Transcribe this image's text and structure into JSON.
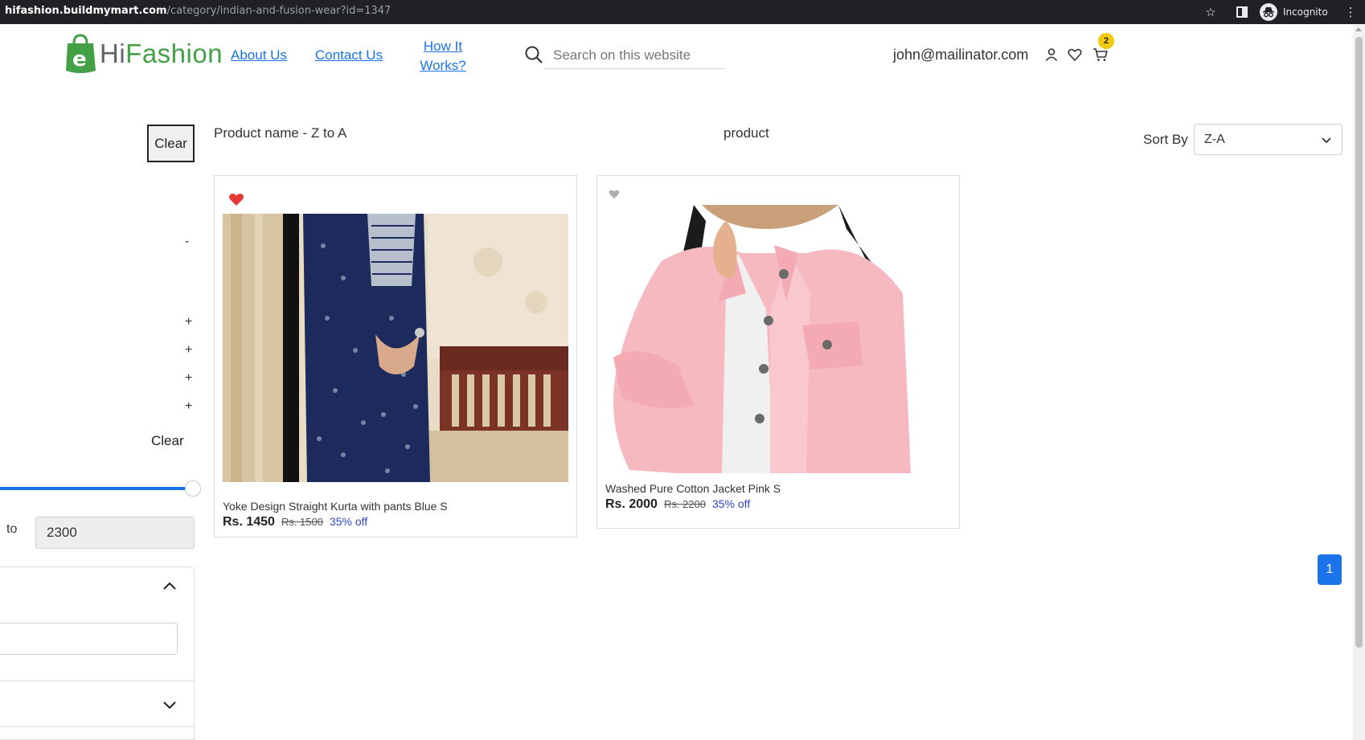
{
  "browser": {
    "url_host": "hifashion.buildmymart.com",
    "url_path": "/category/indian-and-fusion-wear?id=1347",
    "profile_label": "Incognito"
  },
  "header": {
    "logo_hi": "Hi",
    "logo_fashion": "Fashion",
    "nav": {
      "about": "About Us",
      "contact": "Contact Us",
      "how_line1": "How It",
      "how_line2": "Works?"
    },
    "search_placeholder": "Search on this website",
    "user_email": "john@mailinator.com",
    "cart_count": "2"
  },
  "filters": {
    "clear_top": "Clear",
    "toggles": [
      "-",
      "+",
      "+",
      "+",
      "+"
    ],
    "clear_price": "Clear",
    "to_label": "to",
    "price_max": "2300",
    "slider_fraction": 1.0
  },
  "listing": {
    "sort_description": "Product name - Z to A",
    "category_label": "product",
    "sort_by_label": "Sort By",
    "sort_value": "Z-A",
    "products": [
      {
        "name": "Yoke Design Straight Kurta with pants Blue S",
        "price": "Rs. 1450",
        "mrp": "Rs. 1500",
        "discount": "35% off",
        "wishlisted": true
      },
      {
        "name": "Washed Pure Cotton Jacket Pink S",
        "price": "Rs. 2000",
        "mrp": "Rs. 2200",
        "discount": "35% off",
        "wishlisted": false
      }
    ],
    "current_page": "1"
  },
  "colors": {
    "accent_blue": "#1a73e8",
    "logo_green": "#43a047",
    "wishlist_active": "#e53935",
    "wishlist_inactive": "#b0b0b0",
    "discount_text": "#2f46c9",
    "badge_yellow": "#f2c811"
  },
  "icons": {
    "search": "search-icon",
    "user": "user-icon",
    "wishlist": "heart-icon",
    "cart": "cart-icon"
  }
}
